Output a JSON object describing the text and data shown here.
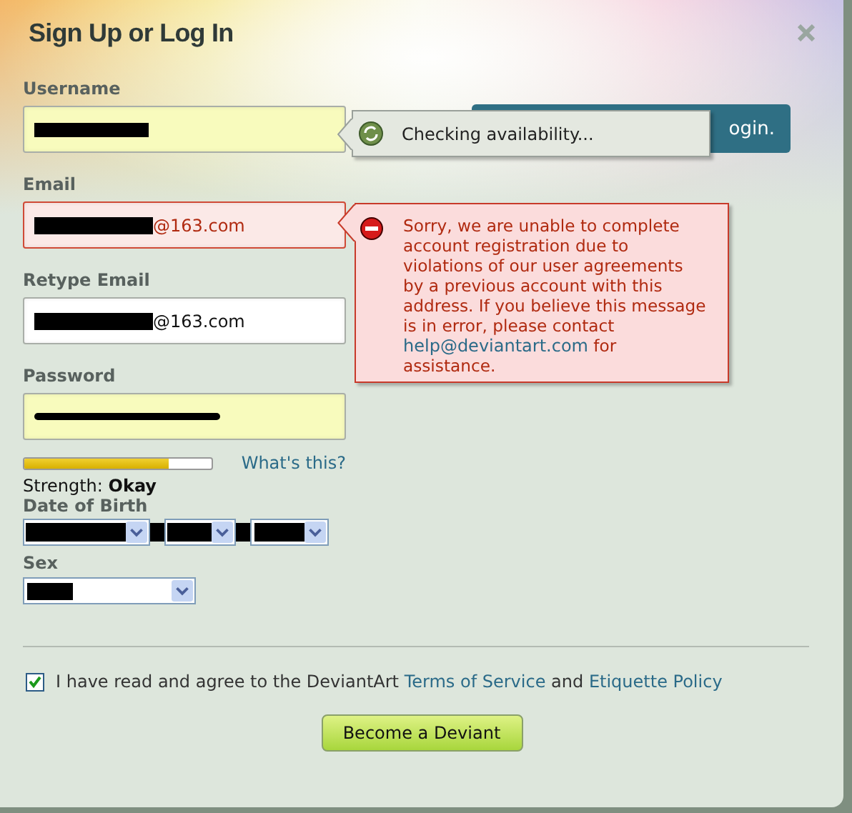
{
  "dialog": {
    "title": "Sign Up or Log In"
  },
  "login_button": {
    "label": "ogin."
  },
  "fields": [
    {
      "label": "Username",
      "highlighted": true,
      "error": false,
      "redacted": true
    },
    {
      "label": "Email",
      "highlighted": false,
      "error": true,
      "redacted": true,
      "value": "@163.com"
    },
    {
      "label": "Retype Email",
      "highlighted": false,
      "error": false,
      "redacted": true,
      "value": "@163.com"
    },
    {
      "label": "Password",
      "highlighted": true,
      "error": false,
      "redacted": true
    }
  ],
  "availability_tooltip": {
    "text": "Checking availability..."
  },
  "error_tooltip": {
    "before": "Sorry, we are unable to complete account registration due to violations of our user agreements by a previous account with this address. If you believe this message is in error, please contact",
    "link": "help@deviantart.com",
    "after": "for assistance."
  },
  "strength": {
    "level": 0.77,
    "label": "Strength: **Okay**",
    "help_link": "What's this?"
  },
  "date_of_birth": {
    "label": "Date of Birth",
    "redacted": true,
    "selects": [
      {
        "kind": "month"
      },
      {
        "kind": "day"
      },
      {
        "kind": "year"
      }
    ]
  },
  "sex": {
    "label": "Sex",
    "redacted": true
  },
  "agreement": {
    "checked": true,
    "text": "I have read and agree to the DeviantArt",
    "links": [
      "Terms of Service",
      "Etiquette Policy"
    ],
    "joiner": "and"
  },
  "submit": {
    "label": "Become a Deviant"
  }
}
